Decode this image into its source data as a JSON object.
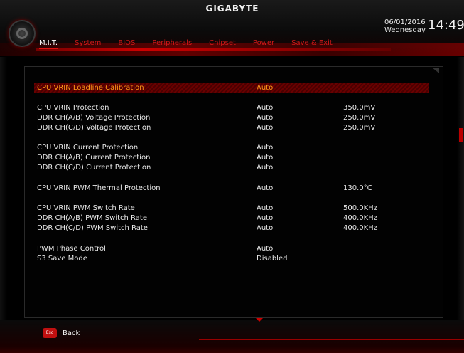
{
  "header": {
    "brand": "GIGABYTE",
    "date": "06/01/2016",
    "weekday": "Wednesday",
    "time": "14:49"
  },
  "tabs": [
    {
      "label": "M.I.T.",
      "active": true
    },
    {
      "label": "System",
      "active": false
    },
    {
      "label": "BIOS",
      "active": false
    },
    {
      "label": "Peripherals",
      "active": false
    },
    {
      "label": "Chipset",
      "active": false
    },
    {
      "label": "Power",
      "active": false
    },
    {
      "label": "Save & Exit",
      "active": false
    }
  ],
  "settings": [
    {
      "label": "CPU VRIN Loadline Calibration",
      "value": "Auto",
      "current": "",
      "selected": true
    },
    {
      "label": "CPU VRIN Protection",
      "value": "Auto",
      "current": "350.0mV"
    },
    {
      "label": "DDR CH(A/B) Voltage Protection",
      "value": "Auto",
      "current": "250.0mV"
    },
    {
      "label": "DDR CH(C/D) Voltage Protection",
      "value": "Auto",
      "current": "250.0mV"
    },
    {
      "label": "CPU VRIN Current Protection",
      "value": "Auto",
      "current": ""
    },
    {
      "label": "DDR CH(A/B) Current Protection",
      "value": "Auto",
      "current": ""
    },
    {
      "label": "DDR CH(C/D) Current Protection",
      "value": "Auto",
      "current": ""
    },
    {
      "label": "CPU VRIN PWM Thermal Protection",
      "value": "Auto",
      "current": "130.0°C"
    },
    {
      "label": "CPU VRIN PWM Switch Rate",
      "value": "Auto",
      "current": "500.0KHz"
    },
    {
      "label": "DDR CH(A/B) PWM Switch Rate",
      "value": "Auto",
      "current": "400.0KHz"
    },
    {
      "label": "DDR CH(C/D) PWM Switch Rate",
      "value": "Auto",
      "current": "400.0KHz"
    },
    {
      "label": "PWM Phase Control",
      "value": "Auto",
      "current": ""
    },
    {
      "label": "S3 Save Mode",
      "value": "Disabled",
      "current": ""
    }
  ],
  "footer": {
    "esc_key": "Esc",
    "back_label": "Back"
  },
  "colors": {
    "accent": "#d01818",
    "selected_text": "#ff9a1a",
    "background": "#000000"
  }
}
